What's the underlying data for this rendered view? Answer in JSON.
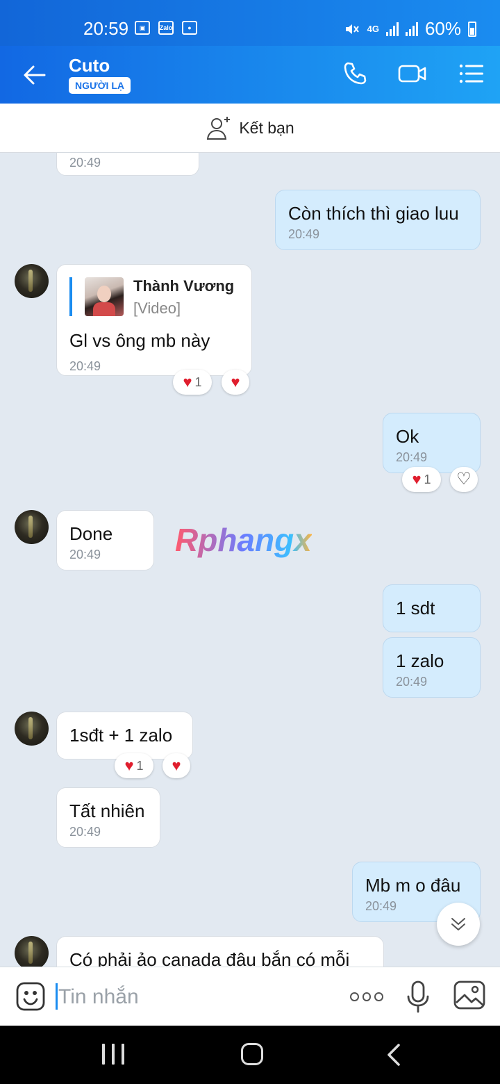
{
  "status_bar": {
    "time": "20:59",
    "icon_zalo": "Zalo",
    "network": "4G",
    "battery": "60%"
  },
  "header": {
    "name": "Cuto",
    "badge": "NGƯỜI LẠ"
  },
  "add_friend": {
    "label": "Kết bạn"
  },
  "messages": {
    "m0_time": "20:49",
    "m1_text": "Còn thích thì giao luu",
    "m1_time": "20:49",
    "m2_quote_name": "Thành Vương",
    "m2_quote_type": "[Video]",
    "m2_text": "Gl vs ông mb này",
    "m2_time": "20:49",
    "m2_react_count": "1",
    "m3_text": "Ok",
    "m3_time": "20:49",
    "m3_react_count": "1",
    "m4_text": "Done",
    "m4_time": "20:49",
    "m5_text": "1 sdt",
    "m6_text": "1 zalo",
    "m6_time": "20:49",
    "m7_text": "1sđt + 1 zalo",
    "m7_react_count": "1",
    "m8_text": "Tất nhiên",
    "m8_time": "20:49",
    "m9_text": "Mb m o đâu",
    "m9_time": "20:49",
    "m10_text": "Có phải ảo canada đâu bắn có mỗi"
  },
  "watermark": "Rphangx",
  "input": {
    "placeholder": "Tin nhắn"
  },
  "icons": [
    "back-arrow-icon",
    "phone-icon",
    "video-call-icon",
    "menu-icon",
    "add-friend-icon",
    "heart-icon",
    "chevron-down-icon",
    "emoji-icon",
    "more-icon",
    "mic-icon",
    "gallery-icon"
  ],
  "colors": {
    "header_start": "#1268e3",
    "header_end": "#1fa3f5",
    "outgoing_bubble": "#d4ecfd",
    "incoming_bubble": "#ffffff",
    "chat_bg": "#e2e9f1",
    "heart": "#e01e2e"
  }
}
